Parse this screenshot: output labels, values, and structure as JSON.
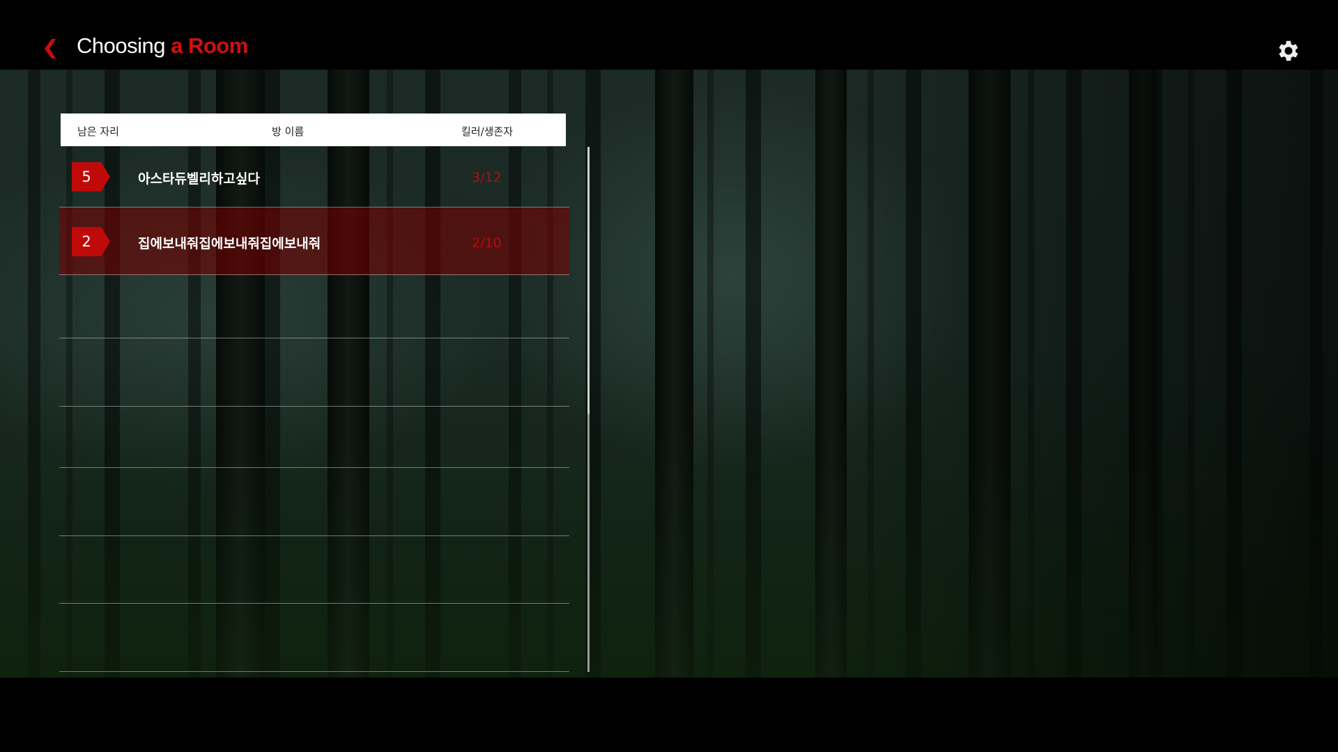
{
  "header": {
    "title_main": "Choosing",
    "title_accent": "a Room"
  },
  "table": {
    "columns": [
      "남은 자리",
      "방 이름",
      "킬러/생존자"
    ],
    "rows": [
      {
        "seats": "5",
        "name": "아스타듀벨리하고싶다",
        "ratio": "3/12",
        "selected": false
      },
      {
        "seats": "2",
        "name": "집에보내줘집에보내줘집에보내줘",
        "ratio": "2/10",
        "selected": true
      }
    ]
  },
  "colors": {
    "accent": "#d10f0f",
    "badge": "#c00a0a"
  }
}
